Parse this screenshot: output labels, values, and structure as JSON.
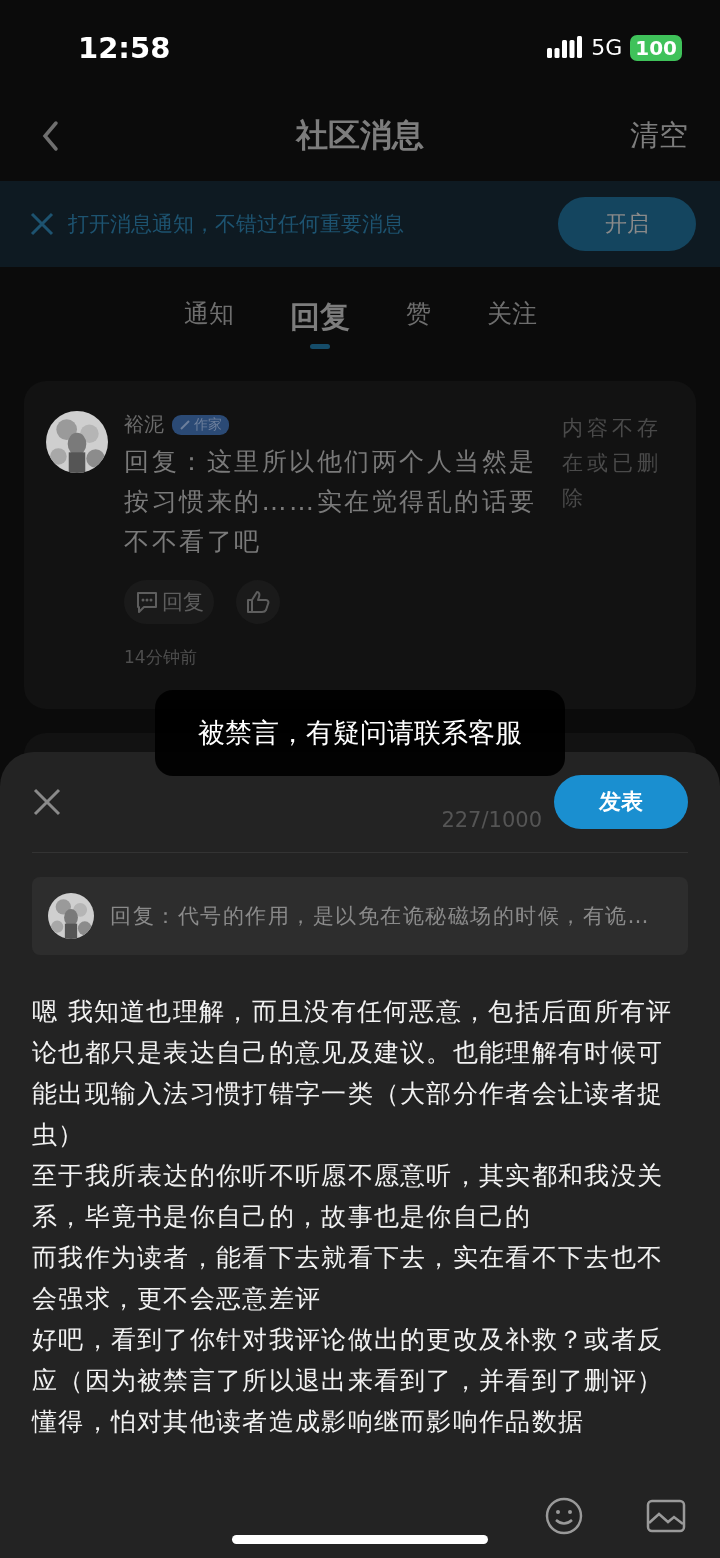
{
  "status_bar": {
    "time": "12:58",
    "network": "5G",
    "battery": "100"
  },
  "nav": {
    "title": "社区消息",
    "action": "清空"
  },
  "banner": {
    "text": "打开消息通知，不错过任何重要消息",
    "button": "开启"
  },
  "tabs": [
    {
      "label": "通知",
      "selected": false
    },
    {
      "label": "回复",
      "selected": true
    },
    {
      "label": "赞",
      "selected": false
    },
    {
      "label": "关注",
      "selected": false
    }
  ],
  "message": {
    "name": "裕泥",
    "badge": "作家",
    "text": "回复：这里所以他们两个人当然是按习惯来的……实在觉得乱的话要不不看了吧",
    "original": "内容不存在或已删除",
    "reply_button": "回复",
    "time": "14分钟前"
  },
  "composer": {
    "counter": "227/1000",
    "publish": "发表",
    "quote": "回复：代号的作用，是以免在诡秘磁场的时候，有诡…",
    "paragraphs": [
      "嗯 我知道也理解，而且没有任何恶意，包括后面所有评论也都只是表达自己的意见及建议。也能理解有时候可能出现输入法习惯打错字一类（大部分作者会让读者捉虫）",
      "至于我所表达的你听不听愿不愿意听，其实都和我没关系，毕竟书是你自己的，故事也是你自己的",
      "而我作为读者，能看下去就看下去，实在看不下去也不会强求，更不会恶意差评",
      "好吧，看到了你针对我评论做出的更改及补救？或者反应（因为被禁言了所以退出来看到了，并看到了删评）懂得，怕对其他读者造成影响继而影响作品数据"
    ]
  },
  "toast": "被禁言，有疑问请联系客服"
}
